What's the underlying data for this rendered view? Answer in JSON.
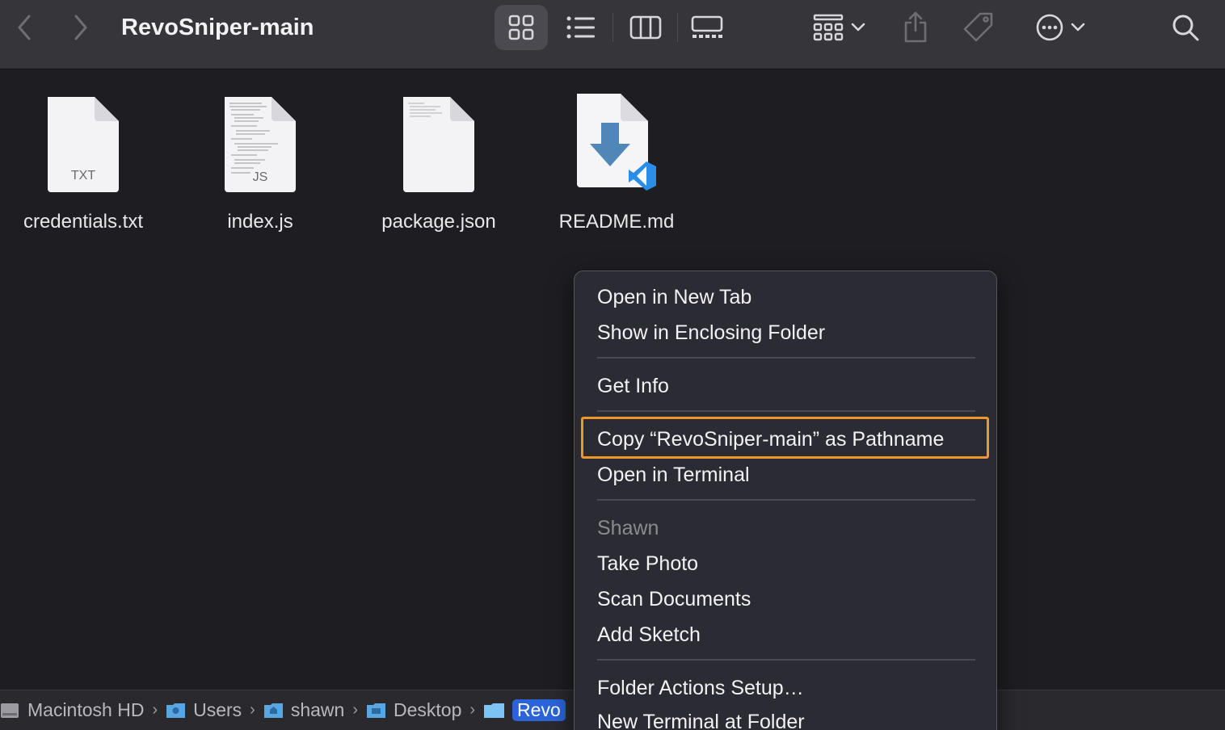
{
  "window": {
    "title": "RevoSniper-main"
  },
  "toolbar": {
    "back_icon": "chevron-left-icon",
    "forward_icon": "chevron-right-icon",
    "views": [
      "icon-view-icon",
      "list-view-icon",
      "column-view-icon",
      "gallery-view-icon"
    ],
    "group_icon": "group-icon",
    "share_icon": "share-icon",
    "tag_icon": "tag-icon",
    "more_icon": "more-icon",
    "search_icon": "search-icon"
  },
  "files": [
    {
      "name": "credentials.txt",
      "badge": "TXT",
      "kind": "txt"
    },
    {
      "name": "index.js",
      "badge": "JS",
      "kind": "js"
    },
    {
      "name": "package.json",
      "badge": "",
      "kind": "json"
    },
    {
      "name": "README.md",
      "badge": "",
      "kind": "md"
    }
  ],
  "pathbar": {
    "items": [
      "Macintosh HD",
      "Users",
      "shawn",
      "Desktop",
      "Revo"
    ]
  },
  "context_menu": {
    "items": [
      "Open in New Tab",
      "Show in Enclosing Folder",
      "Get Info",
      "Copy “RevoSniper-main” as Pathname",
      "Open in Terminal",
      "Shawn",
      "Take Photo",
      "Scan Documents",
      "Add Sketch",
      "Folder Actions Setup…",
      "New Terminal at Folder"
    ],
    "highlight_color": "#f0962a"
  },
  "colors": {
    "background": "#1e1e22",
    "toolbar": "#35353a",
    "selection": "#2b63d9"
  }
}
